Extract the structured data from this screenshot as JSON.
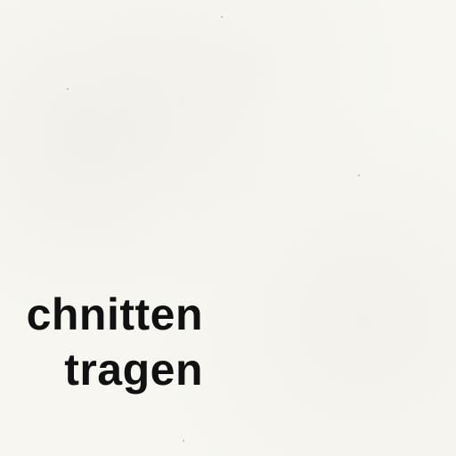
{
  "document": {
    "lines": [
      "chnitten",
      "tragen"
    ]
  },
  "colors": {
    "paper": "#f7f6f1",
    "ink": "#111111"
  }
}
